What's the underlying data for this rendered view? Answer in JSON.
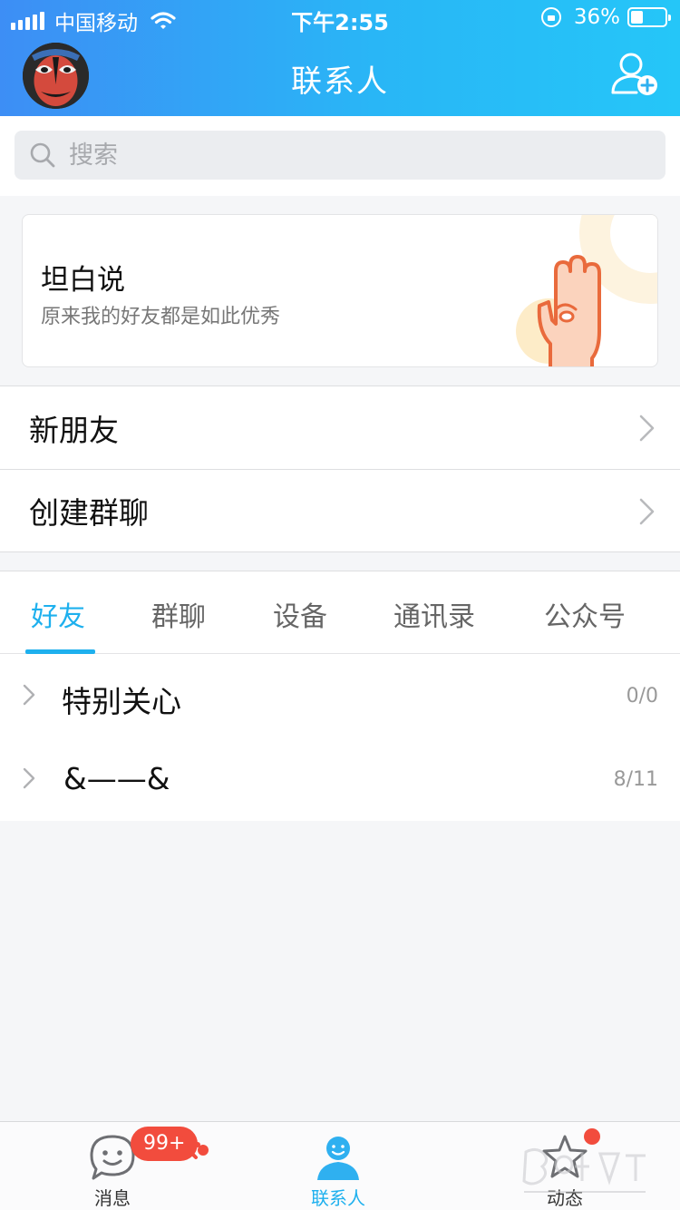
{
  "status_bar": {
    "carrier": "中国移动",
    "time": "下午2:55",
    "battery_text": "36%",
    "battery_level": 0.36
  },
  "header": {
    "title": "联系人",
    "avatar_icon": "opera-mask-avatar",
    "add_icon": "add-friend-icon"
  },
  "search": {
    "placeholder": "搜索"
  },
  "banner": {
    "title": "坦白说",
    "subtitle": "原来我的好友都是如此优秀"
  },
  "list": {
    "new_friends": "新朋友",
    "create_group": "创建群聊"
  },
  "tabs": [
    {
      "label": "好友",
      "active": true
    },
    {
      "label": "群聊"
    },
    {
      "label": "设备"
    },
    {
      "label": "通讯录"
    },
    {
      "label": "公众号"
    }
  ],
  "groups": [
    {
      "name": "特别关心",
      "count": "0/0"
    },
    {
      "name": "&——&",
      "count": "8/11"
    }
  ],
  "bottom_nav": {
    "messages": "消息",
    "contacts": "联系人",
    "feed": "动态",
    "badge": "99+"
  },
  "colors": {
    "header_start": "#3d8ef5",
    "header_end": "#25c6f8",
    "accent": "#1eb0ee",
    "badge": "#f24c3d"
  }
}
